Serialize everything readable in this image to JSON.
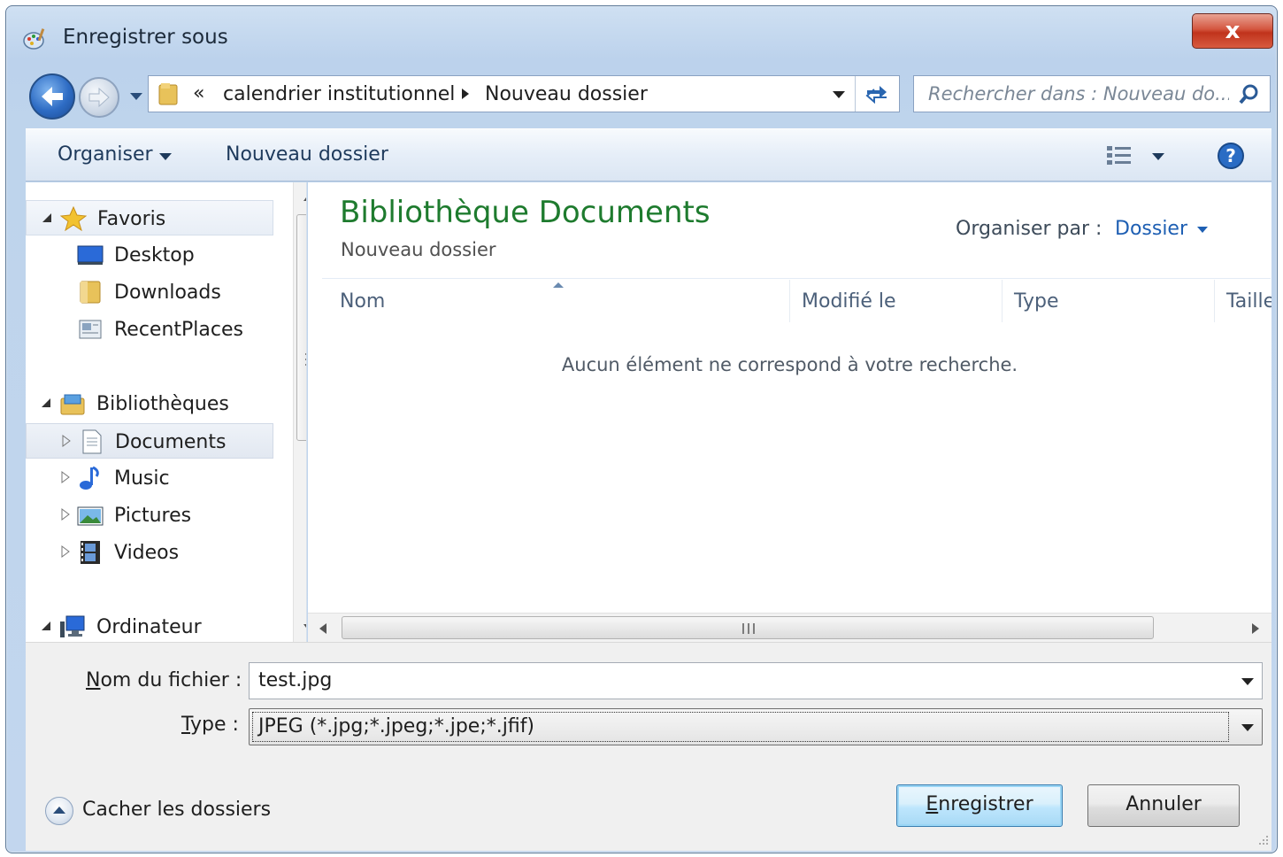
{
  "window": {
    "title": "Enregistrer sous",
    "close_label": "x"
  },
  "navigation": {
    "breadcrumb_overflow": "«",
    "breadcrumbs": [
      "calendrier institutionnel",
      "Nouveau dossier"
    ],
    "search_placeholder": "Rechercher dans : Nouveau do..."
  },
  "toolbar": {
    "organise_label": "Organiser",
    "new_folder_label": "Nouveau dossier"
  },
  "nav_pane": {
    "favorites": {
      "label": "Favoris",
      "items": [
        "Desktop",
        "Downloads",
        "RecentPlaces"
      ]
    },
    "libraries": {
      "label": "Bibliothèques",
      "items": [
        "Documents",
        "Music",
        "Pictures",
        "Videos"
      ]
    },
    "computer": {
      "label": "Ordinateur"
    }
  },
  "content": {
    "library_title": "Bibliothèque Documents",
    "library_subtitle": "Nouveau dossier",
    "arrange_by_label": "Organiser par :",
    "arrange_by_value": "Dossier",
    "columns": [
      "Nom",
      "Modifié le",
      "Type",
      "Taille"
    ],
    "empty_message": "Aucun élément ne correspond à votre recherche."
  },
  "form": {
    "filename_label_prefix": "N",
    "filename_label_rest": "om du fichier :",
    "filename_value": "test.jpg",
    "type_label_prefix": "T",
    "type_label_rest": "ype :",
    "type_value": "JPEG (*.jpg;*.jpeg;*.jpe;*.jfif)"
  },
  "footer": {
    "hide_folders_label": "Cacher les dossiers",
    "save_label_prefix": "E",
    "save_label_rest": "nregistrer",
    "cancel_label": "Annuler"
  },
  "colors": {
    "library_title": "#1e7b2e",
    "arrange_value": "#1e5fb3",
    "close_button": "#c0331c"
  }
}
